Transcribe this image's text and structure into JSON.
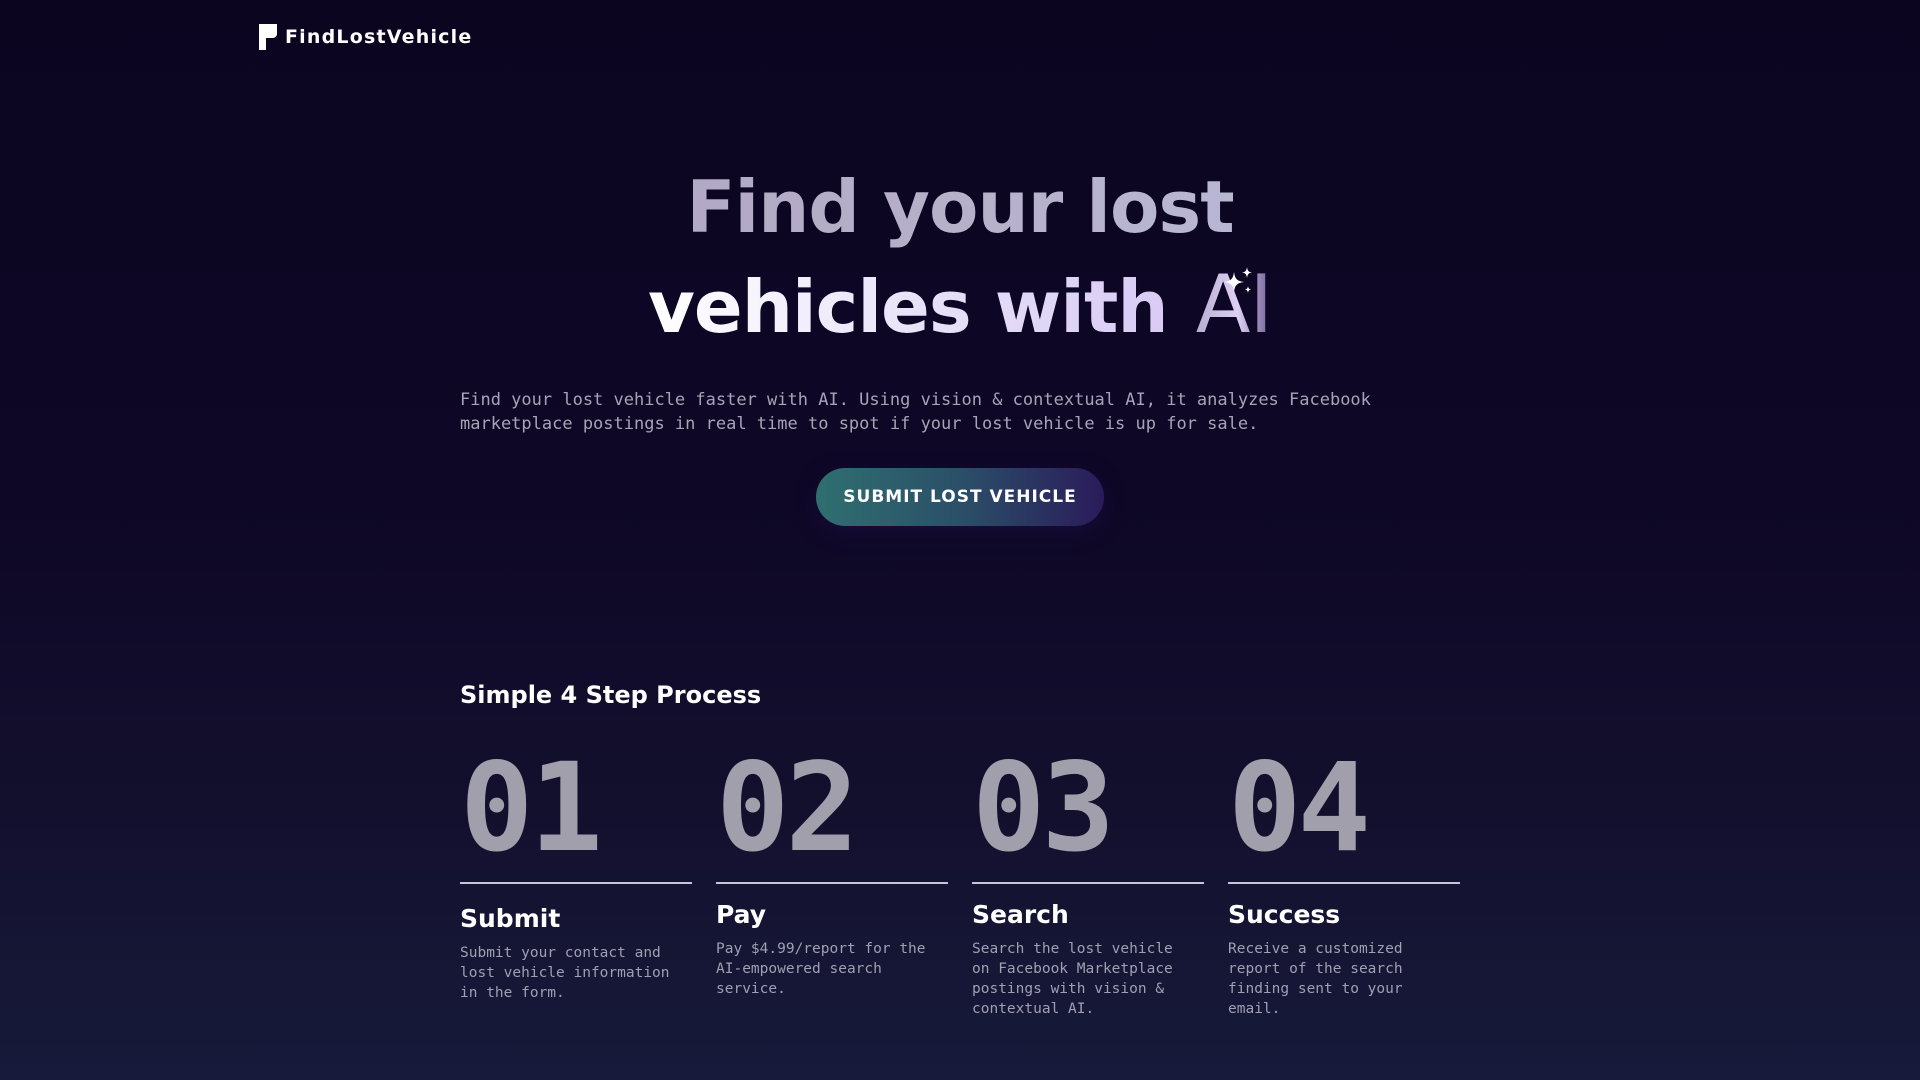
{
  "brand": {
    "name": "FindLostVehicle"
  },
  "hero": {
    "title_line1": "Find your lost",
    "title_line2": "vehicles with",
    "title_ai": "AI",
    "description": "Find your lost vehicle faster with AI. Using vision & contextual AI, it analyzes Facebook marketplace postings in real time to spot if your lost vehicle is up for sale.",
    "cta_label": "SUBMIT LOST VEHICLE"
  },
  "process": {
    "title": "Simple 4 Step Process",
    "steps": [
      {
        "number": "01",
        "name": "Submit",
        "description": "Submit your contact and lost vehicle information in the form."
      },
      {
        "number": "02",
        "name": "Pay",
        "description": "Pay $4.99/report for the AI-empowered search service."
      },
      {
        "number": "03",
        "name": "Search",
        "description": "Search the lost vehicle on Facebook Marketplace postings with vision & contextual AI."
      },
      {
        "number": "04",
        "name": "Success",
        "description": "Receive a customized report of the search finding sent to your email."
      }
    ]
  },
  "icons": {
    "logo": "flag-logo-icon",
    "sparkle": "sparkle-icon"
  },
  "colors": {
    "background_top": "#0b0520",
    "background_bottom": "#171a3a",
    "cta_gradient_start": "#2f6f70",
    "cta_gradient_end": "#2a1b5a",
    "step_number": "#a19fac"
  }
}
